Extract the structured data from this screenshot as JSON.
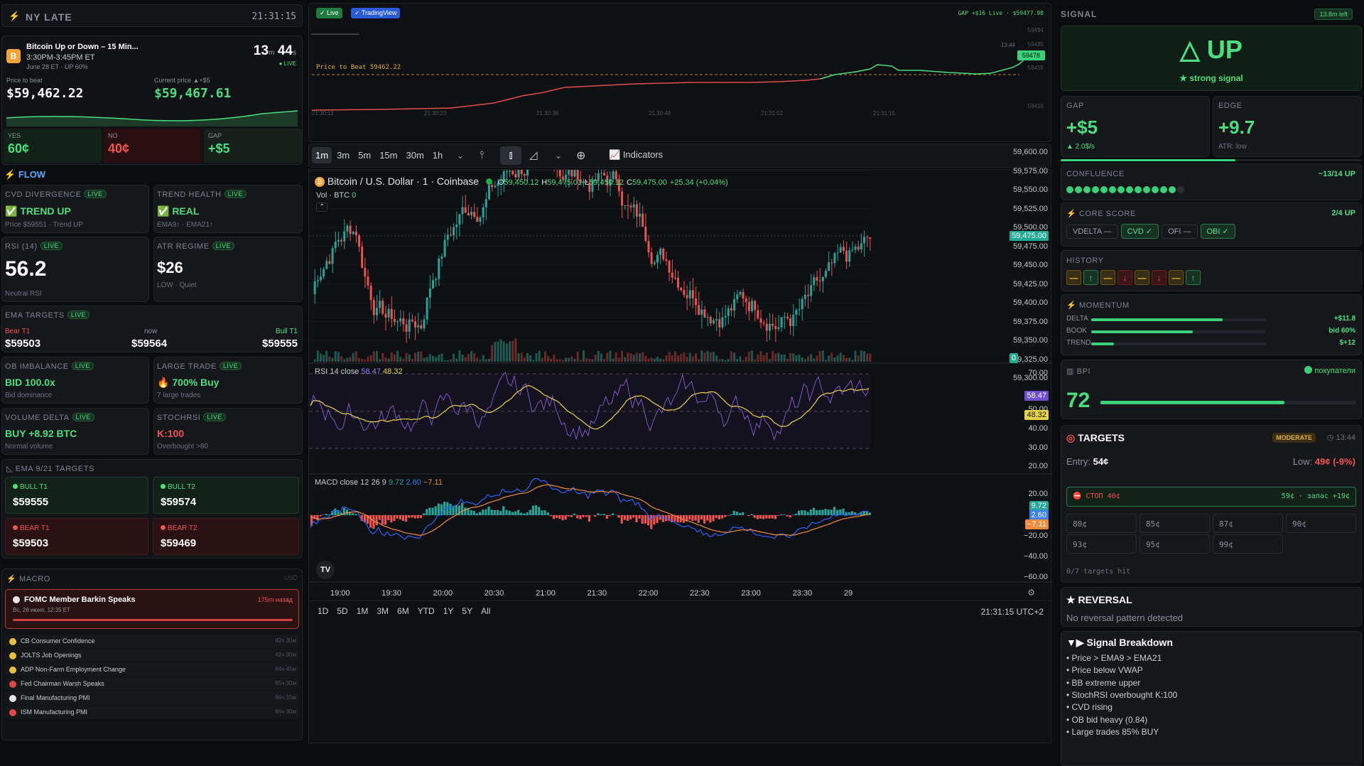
{
  "session": {
    "name": "NY LATE",
    "clock": "21:31:15"
  },
  "market": {
    "title": "Bitcoin Up or Down – 15 Min...",
    "window": "3:30PM-3:45PM ET",
    "meta": "June 28 ET · UP 60%",
    "countdown_m": "13",
    "countdown_m_unit": "m",
    "countdown_s": "44",
    "countdown_s_unit": "s",
    "live": "● LIVE",
    "beat_label": "Price to beat",
    "beat_value": "$59,462.22",
    "current_label": "Current price ▲+$5",
    "current_value": "$59,467.61",
    "yes_label": "YES",
    "yes_value": "60¢",
    "no_label": "NO",
    "no_value": "40¢",
    "gap_label": "GAP",
    "gap_value": "+$5"
  },
  "flow": {
    "title": "FLOW",
    "live": "LIVE",
    "cvd": {
      "label": "CVD DIVERGENCE",
      "value": "✅ TREND UP",
      "sub": "Price $59551 · Trend UP"
    },
    "trend": {
      "label": "TREND HEALTH",
      "value": "✅ REAL",
      "sub": "EMA9↑ · EMA21↑"
    },
    "rsi": {
      "label": "RSI (14)",
      "value": "56.2",
      "sub": "Neutral RSI"
    },
    "atr": {
      "label": "ATR REGIME",
      "value": "$26",
      "sub": "LOW · Quiet"
    },
    "ema": {
      "label": "EMA TARGETS",
      "bear_label": "Bear T1",
      "bear_value": "$59503",
      "now_label": "now",
      "now_value": "$59564",
      "bull_label": "Bull T1",
      "bull_value": "$59555"
    },
    "ob": {
      "label": "OB IMBALANCE",
      "value": "BID 100.0x",
      "sub": "Bid dominance"
    },
    "large": {
      "label": "LARGE TRADE",
      "value": "🔥 700% Buy",
      "sub": "7 large trades"
    },
    "vd": {
      "label": "VOLUME DELTA",
      "value": "BUY +8.92 BTC",
      "sub": "Normal volume"
    },
    "stoch": {
      "label": "STOCHRSI",
      "value": "K:100",
      "sub": "Overbought >80"
    }
  },
  "ema_targets": {
    "title": "EMA 9/21 TARGETS",
    "bull1_label": "BULL T1",
    "bull1": "$59555",
    "bull2_label": "BULL T2",
    "bull2": "$59574",
    "bear1_label": "BEAR T1",
    "bear1": "$59503",
    "bear2_label": "BEAR T2",
    "bear2": "$59469"
  },
  "macro": {
    "title": "MACRO",
    "ccy": "USD",
    "featured": {
      "title": "FOMC Member Barkin Speaks",
      "ago": "175m назад",
      "date": "Вс, 28 июня, 12:35 ET"
    },
    "events": [
      {
        "name": "CB Consumer Confidence",
        "eta": "42ч 30м",
        "color": "#e8c23a"
      },
      {
        "name": "JOLTS Job Openings",
        "eta": "42ч 30м",
        "color": "#e8c23a"
      },
      {
        "name": "ADP Non-Farm Employment Change",
        "eta": "64ч 45м",
        "color": "#e8c23a"
      },
      {
        "name": "Fed Chairman Warsh Speaks",
        "eta": "65ч 30м",
        "color": "#e04848"
      },
      {
        "name": "Final Manufacturing PMI",
        "eta": "66ч 15м",
        "color": "#e6e6e6"
      },
      {
        "name": "ISM Manufacturing PMI",
        "eta": "66ч 30м",
        "color": "#e04848"
      }
    ]
  },
  "mini": {
    "live_btn": "✓ Live",
    "tv_btn": "✓ TradingView",
    "status": "GAP +$16  Live · $59477.98",
    "beat_line": "Price to Beat 59462.22",
    "price_tag": "59478",
    "yticks": [
      "59494",
      "59485",
      "59455",
      "59416"
    ],
    "time_tag": "13:44",
    "xticks": [
      "21:30:11",
      "21:30:23",
      "21:30:36",
      "21:30:48",
      "21:31:02",
      "21:31:15"
    ]
  },
  "toolbar": {
    "intervals": [
      "1m",
      "3m",
      "5m",
      "15m",
      "30m",
      "1h"
    ],
    "indicators": "Indicators"
  },
  "symbol": {
    "name": "Bitcoin / U.S. Dollar · 1 · Coinbase",
    "o": "59,450.12",
    "h": "59,475.01",
    "l": "59,450.12",
    "c": "59,475.00",
    "chg": "+25.34 (+0.04%)",
    "vol": "Vol · BTC",
    "vol_val": "0"
  },
  "price_axis": [
    "59,600.00",
    "59,575.00",
    "59,550.00",
    "59,525.00",
    "59,500.00",
    "59,475.00",
    "59,450.00",
    "59,425.00",
    "59,400.00",
    "59,375.00",
    "59,350.00",
    "59,325.00",
    "59,300.00"
  ],
  "last_price": "59,475.00",
  "vol_tag": "0",
  "rsi_pane": {
    "label": "RSI 14 close",
    "v1": "58.47",
    "v2": "48.32",
    "axis": [
      "70.00",
      "50.00",
      "40.00",
      "30.00",
      "20.00"
    ]
  },
  "macd_pane": {
    "label": "MACD close 12 26 9",
    "v1": "9.72",
    "v2": "2.60",
    "v3": "−7.11",
    "axis": [
      "20.00",
      "−20.00",
      "−40.00",
      "−60.00"
    ]
  },
  "time_axis": [
    "19:00",
    "19:30",
    "20:00",
    "20:30",
    "21:00",
    "21:30",
    "22:00",
    "22:30",
    "23:00",
    "23:30",
    "29"
  ],
  "ranges": [
    "1D",
    "5D",
    "1M",
    "3M",
    "6M",
    "YTD",
    "1Y",
    "5Y",
    "All"
  ],
  "bottom_time": "21:31:15 UTC+2",
  "signal": {
    "label": "SIGNAL",
    "left": "13.8m left",
    "dir": "△ UP",
    "strength": "★ strong signal"
  },
  "gap": {
    "label": "GAP",
    "value": "+$5",
    "sub": "▲ 2.0$/s"
  },
  "edge": {
    "label": "EDGE",
    "value": "+9.7",
    "sub": "ATR: low"
  },
  "confluence": {
    "label": "CONFLUENCE",
    "value": "~13/14 UP",
    "filled": 13,
    "total": 14
  },
  "core": {
    "label": "CORE SCORE",
    "value": "2/4 UP",
    "chips": [
      {
        "t": "VDELTA —",
        "on": false
      },
      {
        "t": "CVD ✓",
        "on": true
      },
      {
        "t": "OFI —",
        "on": false
      },
      {
        "t": "OBI ✓",
        "on": true
      }
    ]
  },
  "history": {
    "label": "HISTORY",
    "items": [
      "—",
      "↑",
      "—",
      "↓",
      "—",
      "↓",
      "—",
      "↑"
    ]
  },
  "momentum": {
    "label": "MOMENTUM",
    "rows": [
      {
        "k": "DELTA",
        "v": "+$11.8",
        "f": 0.75
      },
      {
        "k": "BOOK",
        "v": "bid 60%",
        "f": 0.58
      },
      {
        "k": "TREND",
        "v": "$+12",
        "f": 0.13
      }
    ]
  },
  "bpi": {
    "label": "BPI",
    "state": "покупатели",
    "value": "72",
    "f": 0.72
  },
  "targets": {
    "title": "TARGETS",
    "badge": "MODERATE",
    "time": "13:44",
    "entry_label": "Entry:",
    "entry": "54¢",
    "low_label": "Low:",
    "low": "49¢ (-9%)",
    "stop": "СТОП 40¢",
    "stop_r": "59¢ · запас +19¢",
    "cells": [
      "80¢",
      "85¢",
      "87¢",
      "90¢",
      "93¢",
      "95¢",
      "99¢",
      ""
    ],
    "hit": "0/7 targets hit"
  },
  "reversal": {
    "title": "REVERSAL",
    "text": "No reversal pattern detected"
  },
  "breakdown": {
    "title": "Signal Breakdown",
    "items": [
      "Price > EMA9 > EMA21",
      "Price below VWAP",
      "BB extreme upper",
      "StochRSI overbought K:100",
      "CVD rising",
      "OB bid heavy (0.84)",
      "Large trades 85% BUY"
    ]
  }
}
